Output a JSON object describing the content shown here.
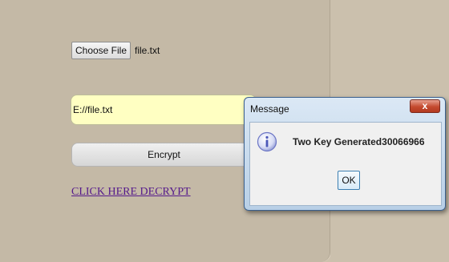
{
  "form": {
    "choose_file_label": "Choose File",
    "selected_file": "file.txt",
    "file_path": "E://file.txt",
    "encrypt_label": "Encrypt",
    "decrypt_link": "CLICK HERE DECRYPT"
  },
  "dialog": {
    "title": "Message",
    "close_glyph": "x",
    "icon": "info-icon",
    "message": "Two Key Generated30066966",
    "ok_label": "OK"
  },
  "colors": {
    "page_background": "#c4b9a6",
    "path_field_background": "#ffffc2",
    "link": "#551a8b",
    "dialog_frame": "#b8cfe6",
    "close_button": "#c44a2f"
  }
}
